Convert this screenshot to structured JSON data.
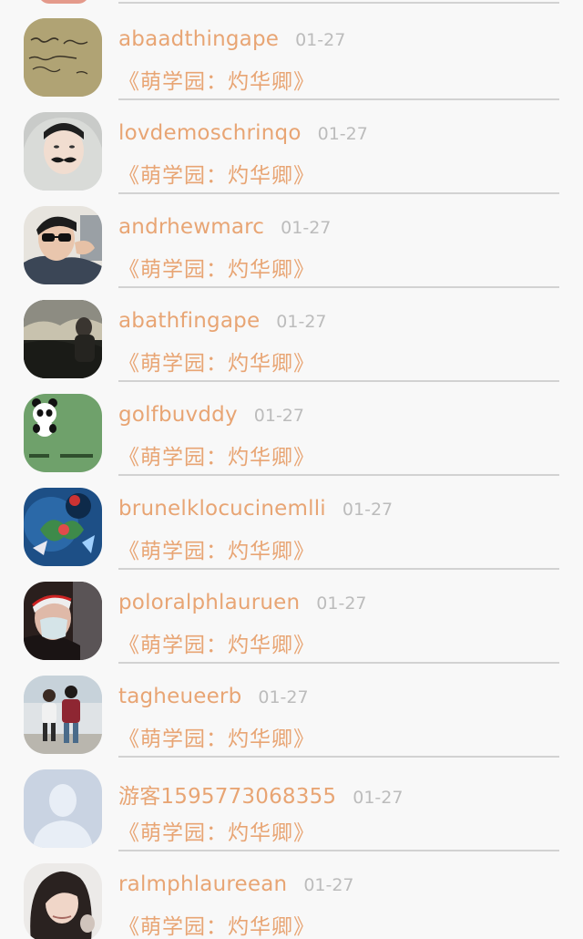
{
  "comments": [
    {
      "username": "abaadthingape",
      "time": "01-27",
      "message": "《萌学园：灼华卿》",
      "avatar": "handwriting-note-avatar"
    },
    {
      "username": "lovdemoschrinqo",
      "time": "01-27",
      "message": "《萌学园：灼华卿》",
      "avatar": "mustache-hoodie-avatar"
    },
    {
      "username": "andrhewmarc",
      "time": "01-27",
      "message": "《萌学园：灼华卿》",
      "avatar": "sunglasses-man-avatar"
    },
    {
      "username": "abathfingape",
      "time": "01-27",
      "message": "《萌学园：灼华卿》",
      "avatar": "dusk-landscape-avatar"
    },
    {
      "username": "golfbuvddy",
      "time": "01-27",
      "message": "《萌学园：灼华卿》",
      "avatar": "panda-cartoon-avatar"
    },
    {
      "username": "brunelklocucinemlli",
      "time": "01-27",
      "message": "《萌学园：灼华卿》",
      "avatar": "game-character-avatar"
    },
    {
      "username": "poloralphlauruen",
      "time": "01-27",
      "message": "《萌学园：灼华卿》",
      "avatar": "masked-man-avatar"
    },
    {
      "username": "tagheueerb",
      "time": "01-27",
      "message": "《萌学园：灼华卿》",
      "avatar": "couple-photo-avatar"
    },
    {
      "username": "游客1595773068355",
      "time": "01-27",
      "message": "《萌学园：灼华卿》",
      "avatar": "default-user-avatar"
    },
    {
      "username": "ralmphlaureean",
      "time": "01-27",
      "message": "《萌学园：灼华卿》",
      "avatar": "girl-portrait-avatar"
    }
  ],
  "colors": {
    "username": "#e8a574",
    "message": "#e8a574",
    "time": "#bcbcbc",
    "divider": "#d2d2d2",
    "background": "#f8f8f8"
  }
}
